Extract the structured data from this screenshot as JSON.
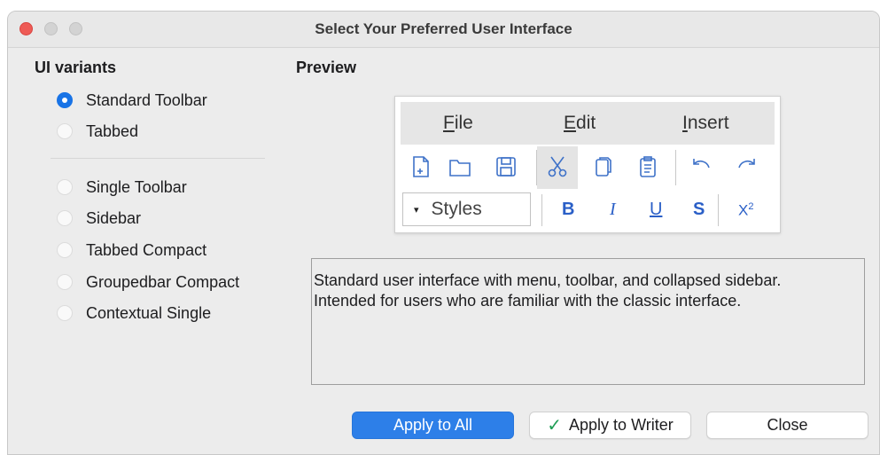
{
  "window": {
    "title": "Select Your Preferred User Interface"
  },
  "ui_variants": {
    "heading": "UI variants",
    "options": [
      {
        "label": "Standard Toolbar",
        "checked": true
      },
      {
        "label": "Tabbed",
        "checked": false
      },
      {
        "label": "Single Toolbar",
        "checked": false
      },
      {
        "label": "Sidebar",
        "checked": false
      },
      {
        "label": "Tabbed Compact",
        "checked": false
      },
      {
        "label": "Groupedbar Compact",
        "checked": false
      },
      {
        "label": "Contextual Single",
        "checked": false
      }
    ]
  },
  "preview": {
    "heading": "Preview",
    "menu": [
      {
        "mnemonic": "F",
        "rest": "ile"
      },
      {
        "mnemonic": "E",
        "rest": "dit"
      },
      {
        "mnemonic": "I",
        "rest": "nsert"
      }
    ],
    "toolbar_icons": [
      "new-document-icon",
      "open-folder-icon",
      "save-icon",
      "cut-icon",
      "copy-icon",
      "paste-icon",
      "undo-icon",
      "redo-icon"
    ],
    "styles_box": {
      "arrow": "▾",
      "label": "Styles"
    },
    "format_buttons": {
      "bold": "B",
      "italic": "I",
      "underline": "U",
      "strikethrough": "S",
      "superscript_base": "X",
      "superscript_exp": "2"
    }
  },
  "description": {
    "line1": "Standard user interface with menu, toolbar, and collapsed sidebar.",
    "line2": "Intended for users who are familiar with the classic interface."
  },
  "buttons": {
    "apply_all": "Apply to All",
    "apply_writer_check": "✓",
    "apply_writer": "Apply to Writer",
    "close": "Close"
  },
  "colors": {
    "accent": "#2d7fe8",
    "radio_selected": "#1873e6",
    "close_light": "#ee5b56",
    "checkmark": "#1f9d55"
  }
}
